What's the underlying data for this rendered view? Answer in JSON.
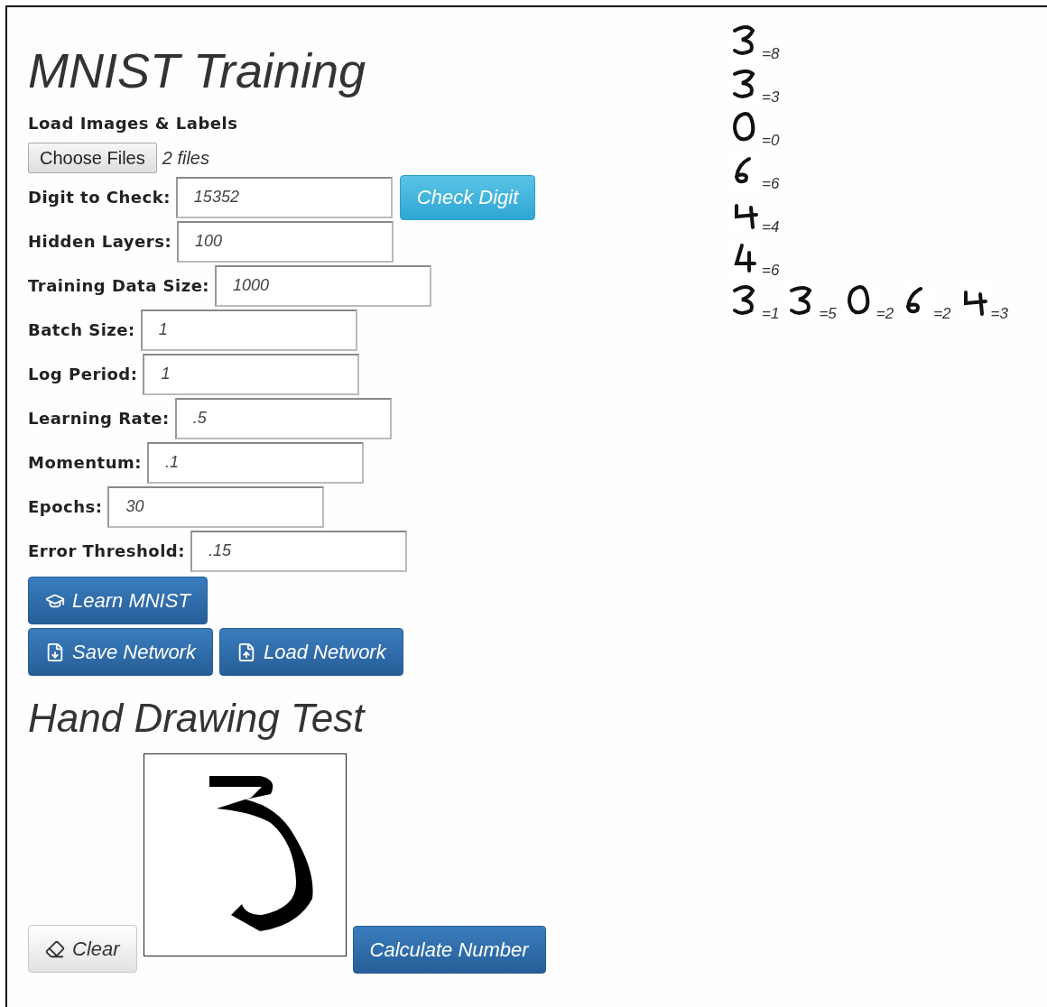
{
  "title": "MNIST Training",
  "file_input": {
    "label": "Load Images & Labels",
    "button": "Choose Files",
    "status": "2 files"
  },
  "fields": [
    {
      "label": "Digit to Check:",
      "value": "15352",
      "button": "Check Digit"
    },
    {
      "label": "Hidden Layers:",
      "value": "100"
    },
    {
      "label": "Training Data Size:",
      "value": "1000"
    },
    {
      "label": "Batch Size:",
      "value": "1"
    },
    {
      "label": "Log Period:",
      "value": "1"
    },
    {
      "label": "Learning Rate:",
      "value": ".5"
    },
    {
      "label": "Momentum:",
      "value": ".1"
    },
    {
      "label": "Epochs:",
      "value": "30"
    },
    {
      "label": "Error Threshold:",
      "value": ".15"
    }
  ],
  "actions": [
    {
      "label": "Learn MNIST",
      "kind": "learn"
    },
    {
      "label": "Save Network",
      "kind": "save"
    },
    {
      "label": "Load Network",
      "kind": "load"
    }
  ],
  "drawing_test": {
    "title": "Hand Drawing Test",
    "clear_button": "Clear",
    "calculate_button": "Calculate Number"
  },
  "results": [
    [
      {
        "prediction": "=8"
      }
    ],
    [
      {
        "prediction": "=3"
      }
    ],
    [
      {
        "prediction": "=0"
      }
    ],
    [
      {
        "prediction": "=6"
      }
    ],
    [
      {
        "prediction": "=4"
      }
    ],
    [
      {
        "prediction": "=6"
      }
    ],
    [
      {
        "prediction": "=1"
      },
      {
        "prediction": "=5"
      },
      {
        "prediction": "=2"
      },
      {
        "prediction": "=2"
      },
      {
        "prediction": "=3"
      }
    ]
  ]
}
